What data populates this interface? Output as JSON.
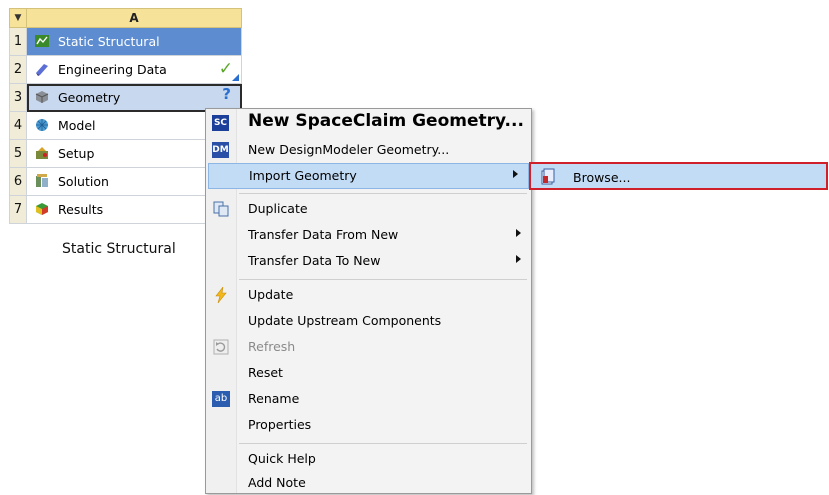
{
  "system": {
    "column_header": "A",
    "rows": [
      {
        "num": "1",
        "label": "Static Structural",
        "icon": "static-structural-icon"
      },
      {
        "num": "2",
        "label": "Engineering Data",
        "icon": "engineering-data-icon",
        "state": "✓"
      },
      {
        "num": "3",
        "label": "Geometry",
        "icon": "geometry-icon",
        "state": "?"
      },
      {
        "num": "4",
        "label": "Model",
        "icon": "model-icon"
      },
      {
        "num": "5",
        "label": "Setup",
        "icon": "setup-icon"
      },
      {
        "num": "6",
        "label": "Solution",
        "icon": "solution-icon"
      },
      {
        "num": "7",
        "label": "Results",
        "icon": "results-icon"
      }
    ],
    "caption": "Static Structural"
  },
  "context_menu": {
    "items": [
      {
        "label": "New SpaceClaim Geometry...",
        "icon": "spaceclaim-icon",
        "icon_text": "SC"
      },
      {
        "label": "New DesignModeler Geometry...",
        "icon": "designmodeler-icon",
        "icon_text": "DM"
      },
      {
        "label": "Import Geometry",
        "has_submenu": true
      },
      {
        "label": "Duplicate",
        "icon": "duplicate-icon"
      },
      {
        "label": "Transfer Data From New",
        "has_submenu": true
      },
      {
        "label": "Transfer Data To New",
        "has_submenu": true
      },
      {
        "label": "Update",
        "icon": "update-lightning-icon"
      },
      {
        "label": "Update Upstream Components"
      },
      {
        "label": "Refresh",
        "icon": "refresh-icon",
        "disabled": true
      },
      {
        "label": "Reset"
      },
      {
        "label": "Rename",
        "icon": "rename-icon",
        "icon_text": "ab"
      },
      {
        "label": "Properties"
      },
      {
        "label": "Quick Help"
      },
      {
        "label": "Add Note"
      }
    ]
  },
  "submenu": {
    "label": "Browse...",
    "icon": "browse-file-icon"
  },
  "colors": {
    "header": "#f7e29a",
    "title_row": "#5d8dd0",
    "selected_row": "#c8d8ef",
    "menu_highlight": "#c3dcf6",
    "submenu_border": "#d0202a",
    "check": "#5aa72a"
  }
}
